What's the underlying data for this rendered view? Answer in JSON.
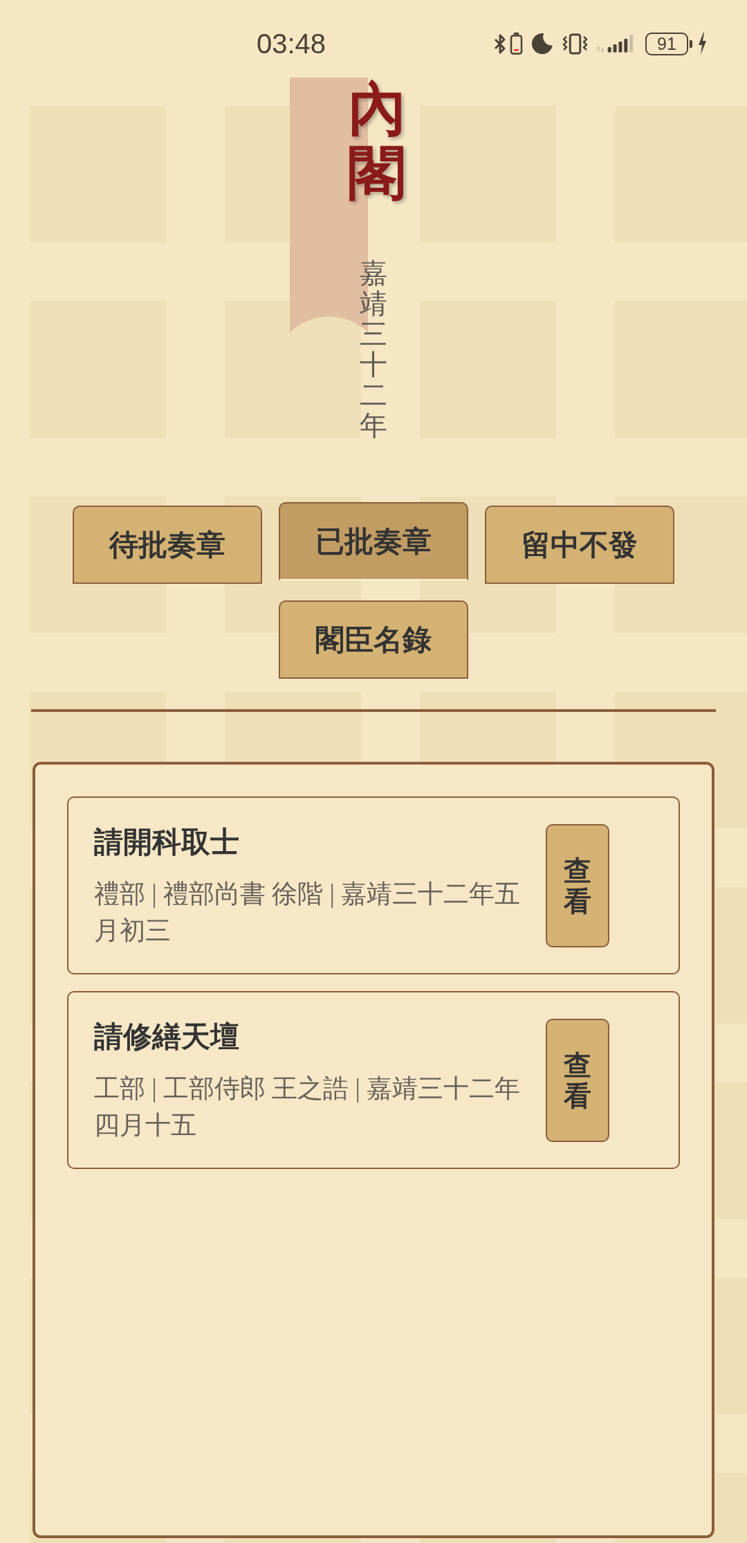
{
  "status_bar": {
    "time": "03:48",
    "battery": "91"
  },
  "header": {
    "title": "內閣",
    "era": "嘉靖三十二年"
  },
  "tabs": [
    {
      "label": "待批奏章",
      "selected": false
    },
    {
      "label": "已批奏章",
      "selected": true
    },
    {
      "label": "留中不發",
      "selected": false
    },
    {
      "label": "閣臣名錄",
      "selected": false
    }
  ],
  "memorials": [
    {
      "title": "請開科取士",
      "meta": "禮部 | 禮部尚書 徐階 | 嘉靖三十二年五月初三",
      "action": "查看"
    },
    {
      "title": "請修繕天壇",
      "meta": "工部 | 工部侍郎 王之誥 | 嘉靖三十二年四月十五",
      "action": "查看"
    }
  ]
}
